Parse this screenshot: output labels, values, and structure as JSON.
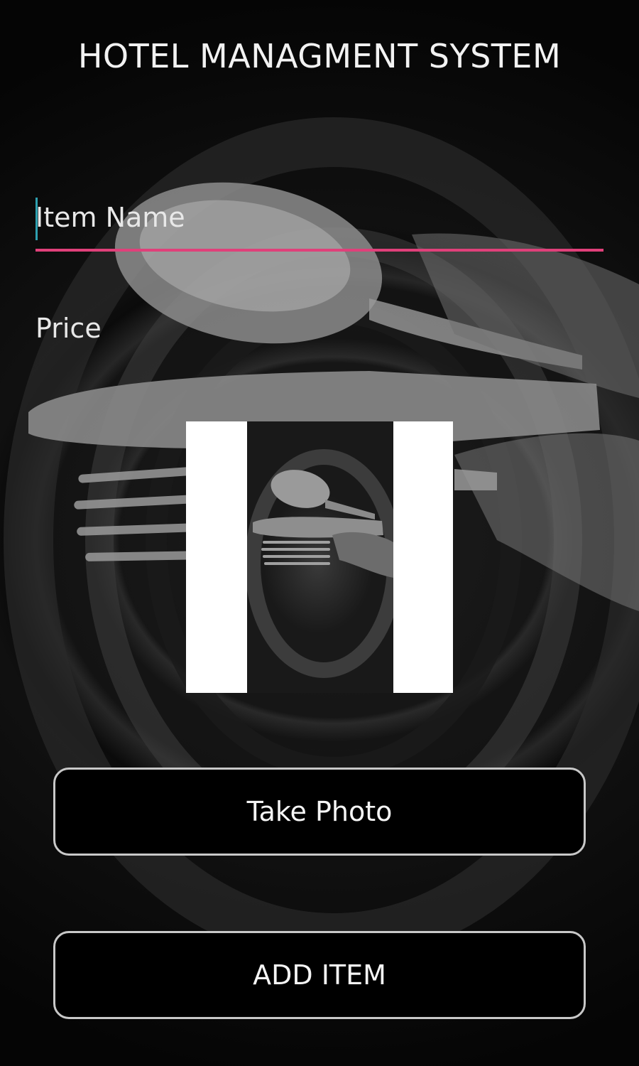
{
  "app": {
    "title": "HOTEL MANAGMENT SYSTEM"
  },
  "form": {
    "item_name": {
      "value": "",
      "placeholder": "Item Name"
    },
    "price": {
      "value": "",
      "placeholder": "Price"
    }
  },
  "buttons": {
    "take_photo_label": "Take Photo",
    "add_item_label": "ADD ITEM"
  },
  "colors": {
    "accent_underline": "#e0407a",
    "caret": "#2ea0b0",
    "button_background": "#000000",
    "button_border": "#c8c8c8",
    "text": "#f2f2f2"
  },
  "icons": {
    "background": "cutlery-plate-background",
    "photo_preview": "cutlery-photo-thumbnail"
  }
}
